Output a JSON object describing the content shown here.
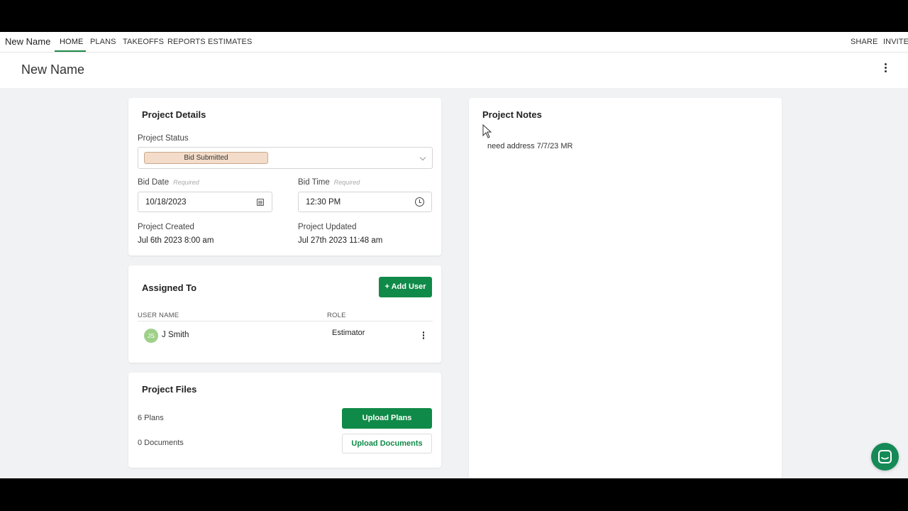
{
  "topnav": {
    "brand": "New Name",
    "links": [
      "HOME",
      "PLANS",
      "TAKEOFFS",
      "REPORTS",
      "ESTIMATES"
    ],
    "active": "HOME",
    "right_links": [
      "SHARE",
      "INVITE"
    ]
  },
  "header": {
    "title": "New Name",
    "menu_icon": "kebab-vertical-icon"
  },
  "project_details": {
    "title": "Project Details",
    "status_label": "Project Status",
    "status_value": "Bid Submitted",
    "bid_date_label": "Bid Date",
    "bid_date_required": "Required",
    "bid_date_value": "10/18/2023",
    "bid_time_label": "Bid Time",
    "bid_time_required": "Required",
    "bid_time_value": "12:30 PM",
    "created_label": "Project Created",
    "created_value": "Jul 6th 2023 8:00 am",
    "updated_label": "Project Updated",
    "updated_value": "Jul 27th 2023 11:48 am"
  },
  "assigned_to": {
    "title": "Assigned To",
    "add_user_label": "+ Add User",
    "col_user": "USER NAME",
    "col_role": "ROLE",
    "users": [
      {
        "initials": "JS",
        "name": "J Smith",
        "role": "Estimator"
      }
    ]
  },
  "project_files": {
    "title": "Project Files",
    "plans_count": "6 Plans",
    "documents_count": "0 Documents",
    "upload_plans_label": "Upload Plans",
    "upload_documents_label": "Upload Documents"
  },
  "project_notes": {
    "title": "Project Notes",
    "text": "need address 7/7/23 MR"
  },
  "colors": {
    "accent": "#108a48",
    "status_chip": "#f3dcc9",
    "avatar": "#9fd08a",
    "chat": "#158a57"
  }
}
